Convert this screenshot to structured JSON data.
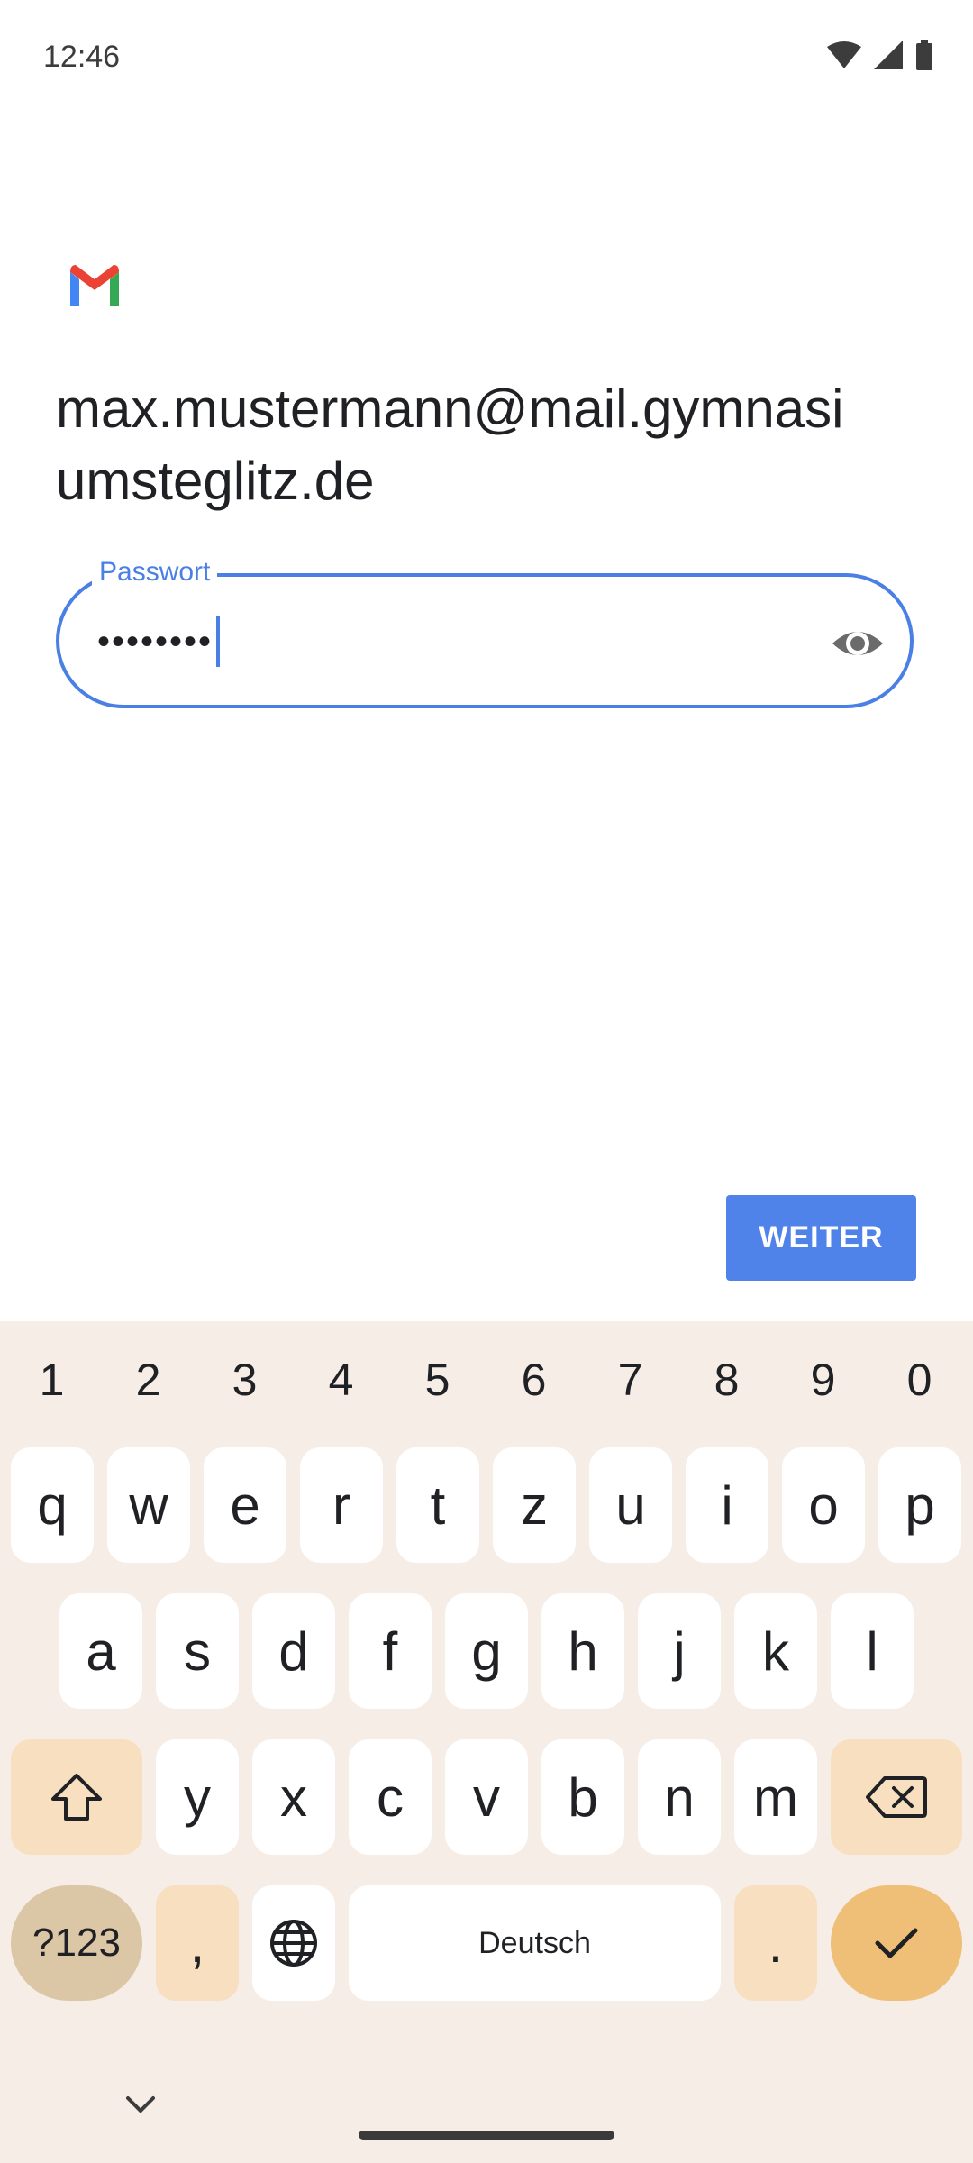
{
  "status_bar": {
    "time": "12:46"
  },
  "account": {
    "email": "max.mustermann@mail.gymnasiumsteglitz.de"
  },
  "password_field": {
    "label": "Passwort",
    "value": "••••••••"
  },
  "next_button": {
    "label": "WEITER"
  },
  "keyboard": {
    "number_row": [
      "1",
      "2",
      "3",
      "4",
      "5",
      "6",
      "7",
      "8",
      "9",
      "0"
    ],
    "row1": [
      "q",
      "w",
      "e",
      "r",
      "t",
      "z",
      "u",
      "i",
      "o",
      "p"
    ],
    "row2": [
      "a",
      "s",
      "d",
      "f",
      "g",
      "h",
      "j",
      "k",
      "l"
    ],
    "row3": [
      "y",
      "x",
      "c",
      "v",
      "b",
      "n",
      "m"
    ],
    "symbols_label": "?123",
    "comma": ",",
    "space_label": "Deutsch",
    "period": "."
  },
  "colors": {
    "accent": "#4a7fe6",
    "button": "#5083ea",
    "keyboard_bg": "#f6ede7"
  }
}
